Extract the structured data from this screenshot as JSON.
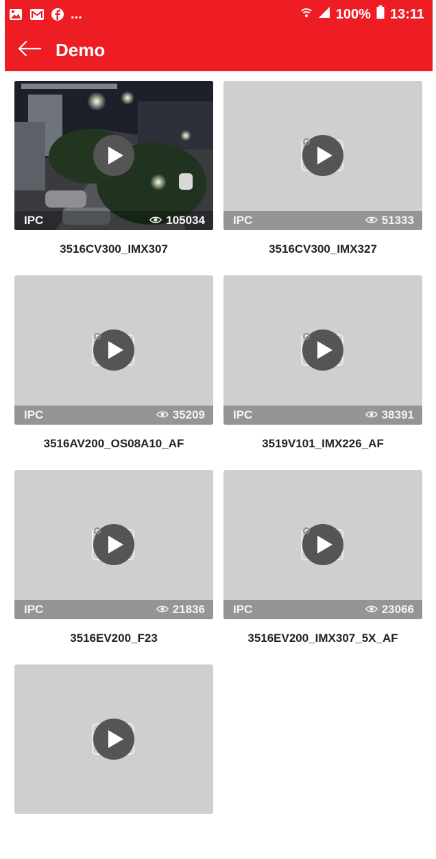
{
  "status_bar": {
    "time": "13:11",
    "battery": "100%",
    "notification_more": "...",
    "icons": [
      "gallery-icon",
      "mail-icon",
      "facebook-icon",
      "wifi-icon",
      "signal-icon",
      "battery-icon"
    ]
  },
  "app_bar": {
    "title": "Demo",
    "back_icon": "back-arrow-icon"
  },
  "colors": {
    "primary": "#ee1d24",
    "placeholder": "#cfcfcf",
    "play_button": "#555555"
  },
  "cards": [
    {
      "tag": "IPC",
      "views": "105034",
      "title": "3516CV300_IMX307",
      "has_preview": true
    },
    {
      "tag": "IPC",
      "views": "51333",
      "title": "3516CV300_IMX327",
      "has_preview": false
    },
    {
      "tag": "IPC",
      "views": "35209",
      "title": "3516AV200_OS08A10_AF",
      "has_preview": false
    },
    {
      "tag": "IPC",
      "views": "38391",
      "title": "3519V101_IMX226_AF",
      "has_preview": false
    },
    {
      "tag": "IPC",
      "views": "21836",
      "title": "3516EV200_F23",
      "has_preview": false
    },
    {
      "tag": "IPC",
      "views": "23066",
      "title": "3516EV200_IMX307_5X_AF",
      "has_preview": false
    },
    {
      "tag": "",
      "views": "",
      "title": "",
      "has_preview": false
    }
  ]
}
